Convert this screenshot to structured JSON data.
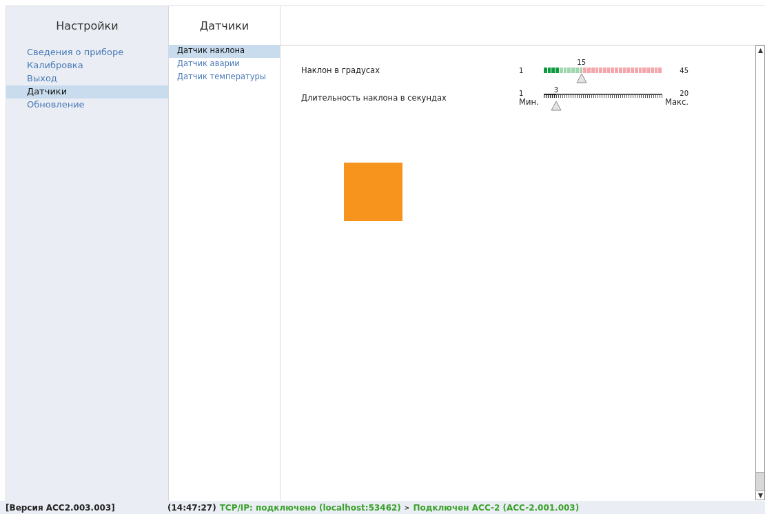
{
  "settings": {
    "title": "Настройки",
    "items": [
      {
        "label": "Сведения о приборе",
        "selected": false
      },
      {
        "label": "Калибровка",
        "selected": false
      },
      {
        "label": "Выход",
        "selected": false
      },
      {
        "label": "Датчики",
        "selected": true
      },
      {
        "label": "Обновление",
        "selected": false
      }
    ]
  },
  "sensors": {
    "title": "Датчики",
    "items": [
      {
        "label": "Датчик наклона",
        "selected": true
      },
      {
        "label": "Датчик аварии",
        "selected": false
      },
      {
        "label": "Датчик температуры",
        "selected": false
      }
    ]
  },
  "sliders": [
    {
      "kind": "segmented",
      "label": "Наклон в градусах",
      "min": "1",
      "max": "45",
      "value": "15",
      "level": 0.318
    },
    {
      "kind": "ruler",
      "label": "Длительность наклона в секундах",
      "min": "1",
      "max": "20",
      "value": "3",
      "min_caption": "Мин.",
      "max_caption": "Макс.",
      "level": 0.105
    }
  ],
  "status_bar": {
    "version": "[Версия ACC2.003.003]",
    "time": "(14:47:27)",
    "connection": "TCP/IP: подключено (localhost:53462)",
    "separator": ">",
    "device": "Подключен ACC-2 (ACC-2.001.003)"
  }
}
